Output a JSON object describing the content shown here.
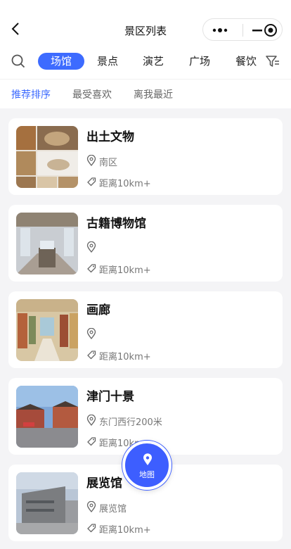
{
  "header": {
    "title": "景区列表"
  },
  "tabs": [
    {
      "label": "场馆",
      "active": true
    },
    {
      "label": "景点",
      "active": false
    },
    {
      "label": "演艺",
      "active": false
    },
    {
      "label": "广场",
      "active": false
    },
    {
      "label": "餐饮",
      "active": false
    }
  ],
  "sort": [
    {
      "label": "推荐排序",
      "active": true
    },
    {
      "label": "最受喜欢",
      "active": false
    },
    {
      "label": "离我最近",
      "active": false
    }
  ],
  "items": [
    {
      "title": "出土文物",
      "location": "南区",
      "distance": "距离10km+"
    },
    {
      "title": "古籍博物馆",
      "location": "",
      "distance": "距离10km+"
    },
    {
      "title": "画廊",
      "location": "",
      "distance": "距离10km+"
    },
    {
      "title": "津门十景",
      "location": "东门西行200米",
      "distance": "距离10km+"
    },
    {
      "title": "展览馆",
      "location": "展览馆",
      "distance": "距离10km+"
    }
  ],
  "map_button": {
    "label": "地图"
  },
  "colors": {
    "accent": "#3d6bff",
    "map_button": "#3d5eff"
  },
  "icons": [
    "back-icon",
    "more-icon",
    "minimize-icon",
    "target-icon",
    "search-icon",
    "filter-icon",
    "location-pin-icon",
    "tag-icon",
    "map-pin-icon"
  ]
}
